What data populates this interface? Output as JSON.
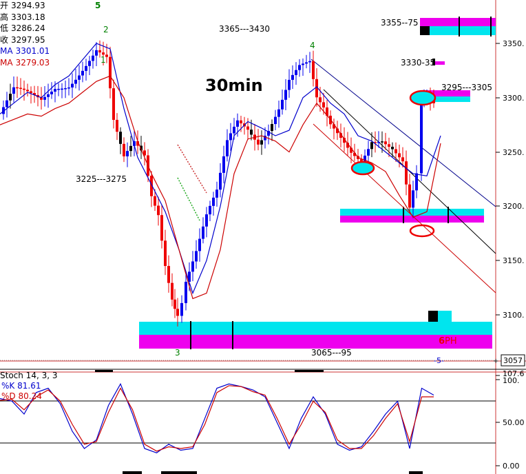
{
  "ohlc_legend": {
    "open_label": "开",
    "open": "3294.93",
    "high_label": "高",
    "high": "3303.18",
    "low_label": "低",
    "low": "3286.24",
    "close_label": "收",
    "close": "3297.95",
    "ma1_label": "MA",
    "ma1": "3301.01",
    "ma2_label": "MA",
    "ma2": "3279.03"
  },
  "timeframe_label": "30min",
  "current_price": "3057",
  "colors": {
    "up": "#0000ee",
    "down": "#ee0000",
    "ma_blue": "#0000cc",
    "ma_red": "#cc0000",
    "cyan": "#00e5ee",
    "magenta": "#ee00ee",
    "green_wave": "#228b22"
  },
  "chart_data": [
    {
      "type": "line",
      "title": "",
      "ylim": [
        3057,
        3375
      ],
      "yticks": [
        "3350.",
        "3300.",
        "3250.",
        "3200.",
        "3150.",
        "3100."
      ],
      "series": [
        {
          "name": "MA",
          "color": "#0000cc",
          "x": [
            0,
            20,
            40,
            60,
            80,
            100,
            120,
            140,
            160,
            180,
            200,
            220,
            240,
            260,
            280,
            300,
            320,
            340,
            360,
            380,
            400,
            420,
            440,
            460,
            480,
            500,
            520,
            540,
            560,
            580,
            600,
            620,
            640
          ],
          "values": [
            3285,
            3295,
            3305,
            3300,
            3312,
            3320,
            3335,
            3350,
            3345,
            3290,
            3245,
            3220,
            3195,
            3160,
            3120,
            3150,
            3200,
            3265,
            3278,
            3272,
            3265,
            3270,
            3300,
            3310,
            3295,
            3285,
            3265,
            3260,
            3250,
            3240,
            3230,
            3228,
            3265
          ]
        },
        {
          "name": "MA",
          "color": "#cc0000",
          "x": [
            0,
            20,
            40,
            60,
            80,
            100,
            120,
            140,
            160,
            180,
            200,
            220,
            240,
            260,
            280,
            300,
            320,
            340,
            360,
            380,
            400,
            420,
            440,
            460,
            480,
            500,
            520,
            540,
            560,
            580,
            600,
            620,
            640
          ],
          "values": [
            3275,
            3280,
            3285,
            3283,
            3290,
            3295,
            3305,
            3315,
            3320,
            3300,
            3260,
            3230,
            3205,
            3160,
            3115,
            3120,
            3160,
            3230,
            3262,
            3265,
            3260,
            3250,
            3275,
            3295,
            3280,
            3262,
            3245,
            3240,
            3232,
            3210,
            3190,
            3195,
            3258
          ]
        }
      ],
      "annotations": [
        {
          "text": "5",
          "color": "#008000"
        },
        {
          "text": "2",
          "color": "#008000"
        },
        {
          "text": "1",
          "color": "#008000"
        },
        {
          "text": "4",
          "color": "#008000"
        },
        {
          "text": "3",
          "color": "#008000"
        },
        {
          "text": "3365---3430"
        },
        {
          "text": "3225---3275"
        },
        {
          "text": "3355--75"
        },
        {
          "text": "3330-35"
        },
        {
          "text": "3295---3305"
        },
        {
          "text": "3065---95"
        },
        {
          "text": "6",
          "color": "#ee0000"
        },
        {
          "text": "PH",
          "color": "#ee0000"
        },
        {
          "text": "-5-",
          "color": "#0000cc"
        }
      ]
    },
    {
      "type": "line",
      "title": "Stoch 14, 3, 3",
      "ylim": [
        0,
        107.6
      ],
      "yticks": [
        "107.6",
        "100.",
        "50.00",
        "0.00"
      ],
      "series": [
        {
          "name": "%K",
          "last": "81.61",
          "color": "#0000cc",
          "values": [
            78,
            75,
            60,
            85,
            90,
            72,
            40,
            20,
            30,
            70,
            95,
            60,
            20,
            15,
            25,
            18,
            20,
            55,
            90,
            95,
            92,
            88,
            80,
            50,
            20,
            55,
            80,
            60,
            25,
            18,
            22,
            40,
            60,
            75,
            20,
            90,
            82
          ]
        },
        {
          "name": "%D",
          "last": "80.24",
          "color": "#cc0000",
          "values": [
            76,
            77,
            65,
            80,
            88,
            75,
            48,
            25,
            28,
            62,
            90,
            65,
            25,
            17,
            22,
            20,
            22,
            48,
            85,
            93,
            92,
            86,
            82,
            55,
            25,
            48,
            75,
            62,
            30,
            20,
            20,
            35,
            55,
            72,
            28,
            80,
            80
          ]
        }
      ]
    }
  ]
}
